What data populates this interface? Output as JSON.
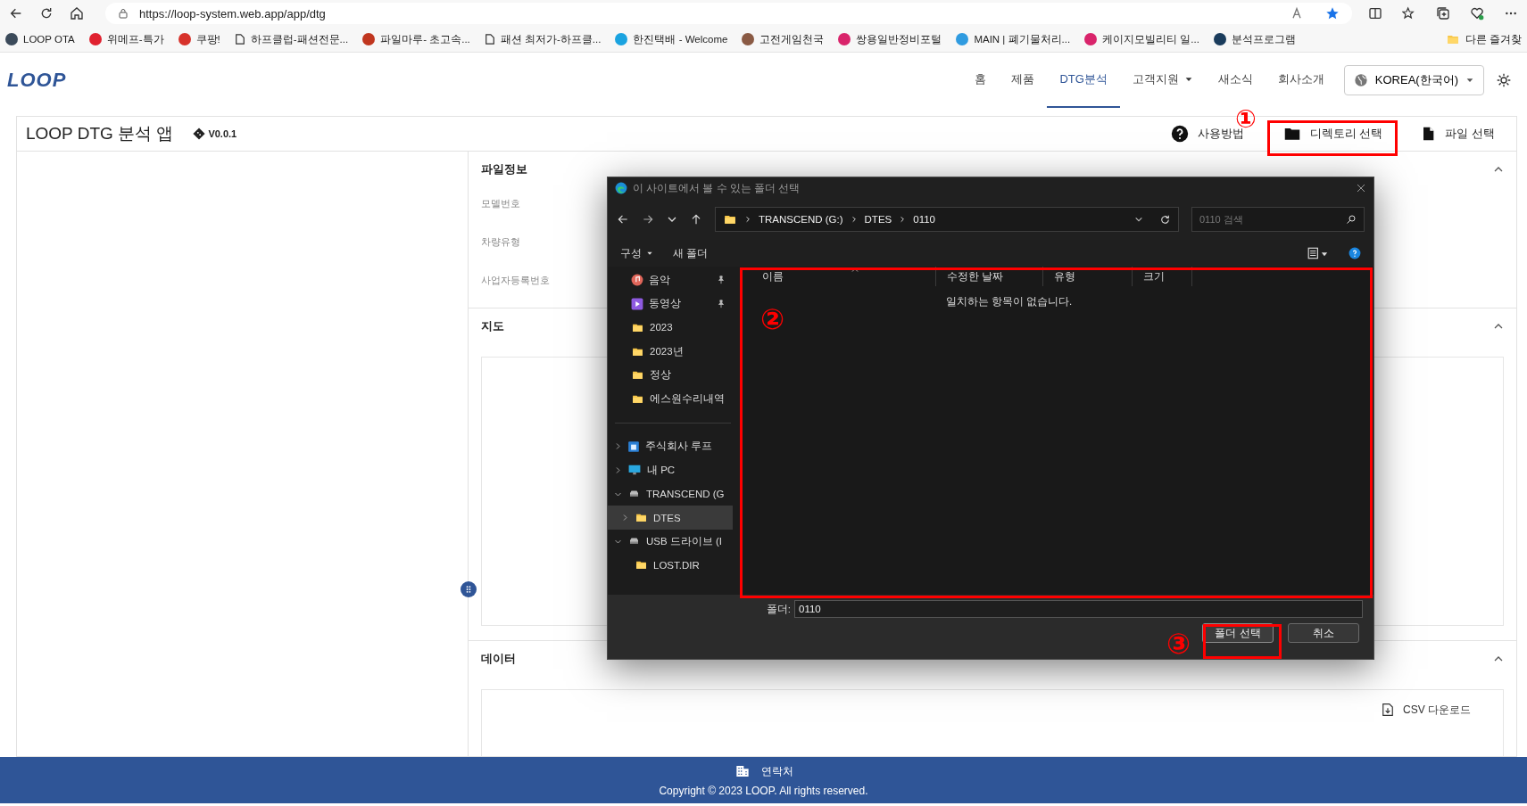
{
  "browser": {
    "address": "https://loop-system.web.app/app/dtg",
    "bookmarks": [
      {
        "label": "LOOP OTA",
        "kind": "badge",
        "color": "#3b4a5a"
      },
      {
        "label": "위메프-특가",
        "kind": "badge",
        "color": "#e0212f"
      },
      {
        "label": "쿠팡!",
        "kind": "badge",
        "color": "#d7322b"
      },
      {
        "label": "하프클럽-패션전문...",
        "kind": "doc"
      },
      {
        "label": "파일마루- 초고속...",
        "kind": "badge",
        "color": "#c0361f"
      },
      {
        "label": "패션 최저가-하프클...",
        "kind": "doc"
      },
      {
        "label": "한진택배 - Welcome",
        "kind": "badge",
        "color": "#1aa3e0"
      },
      {
        "label": "고전게임천국",
        "kind": "badge",
        "color": "#8a5a44"
      },
      {
        "label": "쌍용일반정비포털",
        "kind": "badge",
        "color": "#d9246b"
      },
      {
        "label": "MAIN | 폐기물처리...",
        "kind": "badge",
        "color": "#2f9be0"
      },
      {
        "label": "케이지모빌리티 일...",
        "kind": "badge",
        "color": "#d9246b"
      },
      {
        "label": "분석프로그램",
        "kind": "badge",
        "color": "#1a3c5c"
      }
    ],
    "other_favorites": "다른 즐겨찾"
  },
  "app": {
    "logo": "LOOP",
    "nav": [
      {
        "label": "홈",
        "selected": false,
        "dropdown": false
      },
      {
        "label": "제품",
        "selected": false,
        "dropdown": false
      },
      {
        "label": "DTG분석",
        "selected": true,
        "dropdown": false
      },
      {
        "label": "고객지원",
        "selected": false,
        "dropdown": true
      },
      {
        "label": "새소식",
        "selected": false,
        "dropdown": false
      },
      {
        "label": "회사소개",
        "selected": false,
        "dropdown": false
      }
    ],
    "language": "KOREA(한국어)"
  },
  "card": {
    "title": "LOOP DTG 분석 앱",
    "version": "V0.0.1",
    "actions": [
      {
        "label": "사용방법",
        "kind": "help"
      },
      {
        "label": "디렉토리 선택",
        "kind": "folder"
      },
      {
        "label": "파일 선택",
        "kind": "file"
      }
    ]
  },
  "sections": [
    {
      "title": "파일정보",
      "expanded": true,
      "kind": "fields",
      "fields": [
        "모델번호",
        "차량유형",
        "사업자등록번호"
      ]
    },
    {
      "title": "지도",
      "expanded": true,
      "kind": "map"
    },
    {
      "title": "데이터",
      "expanded": true,
      "kind": "data",
      "download": "CSV 다운로드"
    }
  ],
  "dialog": {
    "title": "이 사이트에서 볼 수 있는 폴더 선택",
    "path": [
      "TRANSCEND (G:)",
      "DTES",
      "0110"
    ],
    "search_placeholder": "0110 검색",
    "commands": [
      {
        "label": "구성",
        "dropdown": true
      },
      {
        "label": "새 폴더",
        "dropdown": false
      }
    ],
    "quick_access": [
      {
        "label": "음악",
        "kind": "music",
        "pinned": true,
        "selected": false
      },
      {
        "label": "동영상",
        "kind": "video",
        "pinned": true,
        "selected": false
      },
      {
        "label": "2023",
        "kind": "folder",
        "pinned": false,
        "selected": false
      },
      {
        "label": "2023년",
        "kind": "folder",
        "pinned": false,
        "selected": false
      },
      {
        "label": "정상",
        "kind": "folder",
        "pinned": false,
        "selected": false
      },
      {
        "label": "에스원수리내역",
        "kind": "folder",
        "pinned": false,
        "selected": false
      }
    ],
    "tree": [
      {
        "label": "주식회사 루프",
        "kind": "cloud",
        "expanded": false,
        "selected": false
      },
      {
        "label": "내 PC",
        "kind": "pc",
        "expanded": false,
        "selected": false
      },
      {
        "label": "TRANSCEND (G",
        "kind": "drive",
        "expanded": true,
        "selected": false,
        "children": [
          {
            "label": "DTES",
            "kind": "folder",
            "expanded": false,
            "selected": true
          }
        ]
      },
      {
        "label": "USB 드라이브 (I",
        "kind": "drive",
        "expanded": true,
        "selected": false,
        "children": [
          {
            "label": "LOST.DIR",
            "kind": "folder",
            "selected": false
          }
        ]
      }
    ],
    "columns": [
      "이름",
      "수정한 날짜",
      "유형",
      "크기"
    ],
    "empty_message": "일치하는 항목이 없습니다.",
    "folder_label": "폴더:",
    "folder_value": "0110",
    "buttons": [
      {
        "label": "폴더 선택",
        "kind": "primary"
      },
      {
        "label": "취소",
        "kind": "secondary"
      }
    ]
  },
  "annotations": [
    {
      "label": "①"
    },
    {
      "label": "②"
    },
    {
      "label": "③"
    }
  ],
  "footer": {
    "contact": "연락처",
    "copyright": "Copyright © 2023 LOOP. All rights reserved."
  }
}
